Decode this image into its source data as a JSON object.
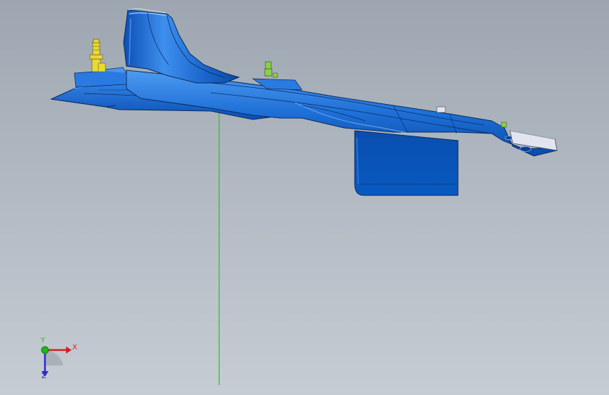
{
  "viewport": {
    "background_top": "#9da6b0",
    "background_bottom": "#c6ccd3"
  },
  "model": {
    "part_color": "#1e6fd6",
    "edge_color": "#0a2f66",
    "fastener_yellow": "#e8d838",
    "fastener_green": "#8ad04a",
    "bracket_color": "#d8dae8",
    "axis_line_color": "#22c22a"
  },
  "triad": {
    "x_label": "X",
    "y_label": "Y",
    "z_label": "Z",
    "x_color": "#d81c1c",
    "y_color": "#1cb81c",
    "z_color": "#2a2ad0"
  }
}
